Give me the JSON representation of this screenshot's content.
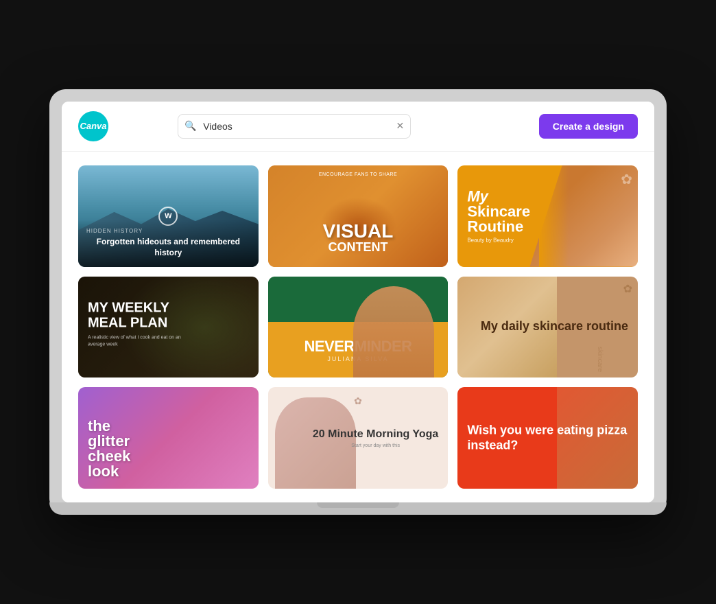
{
  "header": {
    "logo_text": "Canva",
    "search_placeholder": "Videos",
    "search_value": "Videos",
    "create_button_label": "Create a design"
  },
  "grid": {
    "cards": [
      {
        "id": 1,
        "type": "landscape",
        "badge": "W",
        "subtitle": "HIDDEN HISTORY",
        "title": "Forgotten hideouts and remembered history",
        "bg_color": "#7ab8d4"
      },
      {
        "id": 2,
        "type": "food",
        "top_text": "ENCOURAGE FANS TO SHARE",
        "main_text_1": "VISUAL",
        "main_text_2": "CONTENT",
        "bg_color": "#d4832a"
      },
      {
        "id": 3,
        "type": "skincare",
        "line1": "My",
        "line2": "Skincare",
        "line3": "Routine",
        "sub": "Beauty by Beaudry",
        "bg_color": "#e8980a"
      },
      {
        "id": 4,
        "type": "meal",
        "title_line1": "MY WEEKLY",
        "title_line2": "MEAL PLAN",
        "sub": "A realistic view of what I cook and eat on an average week",
        "bg_color": "#2a2010"
      },
      {
        "id": 5,
        "type": "music",
        "title": "NEVERMINDER",
        "name": "JULIANA SILVA",
        "bg_top": "#1a6a3a",
        "bg_bottom": "#e8a020"
      },
      {
        "id": 6,
        "type": "skincare2",
        "title": "My daily skincare routine",
        "bg_color": "#c4956a"
      },
      {
        "id": 7,
        "type": "glitter",
        "title_line1": "the",
        "title_line2": "glitter",
        "title_line3": "cheek",
        "title_line4": "look",
        "bg_color_1": "#a060d0",
        "bg_color_2": "#d060a0"
      },
      {
        "id": 8,
        "type": "yoga",
        "title": "20 Minute Morning Yoga",
        "sub": "Start your day with this",
        "bg_color": "#f5e8e0"
      },
      {
        "id": 9,
        "type": "pizza",
        "title": "Wish you were eating pizza instead?",
        "bg_color": "#e83a1a"
      }
    ]
  }
}
